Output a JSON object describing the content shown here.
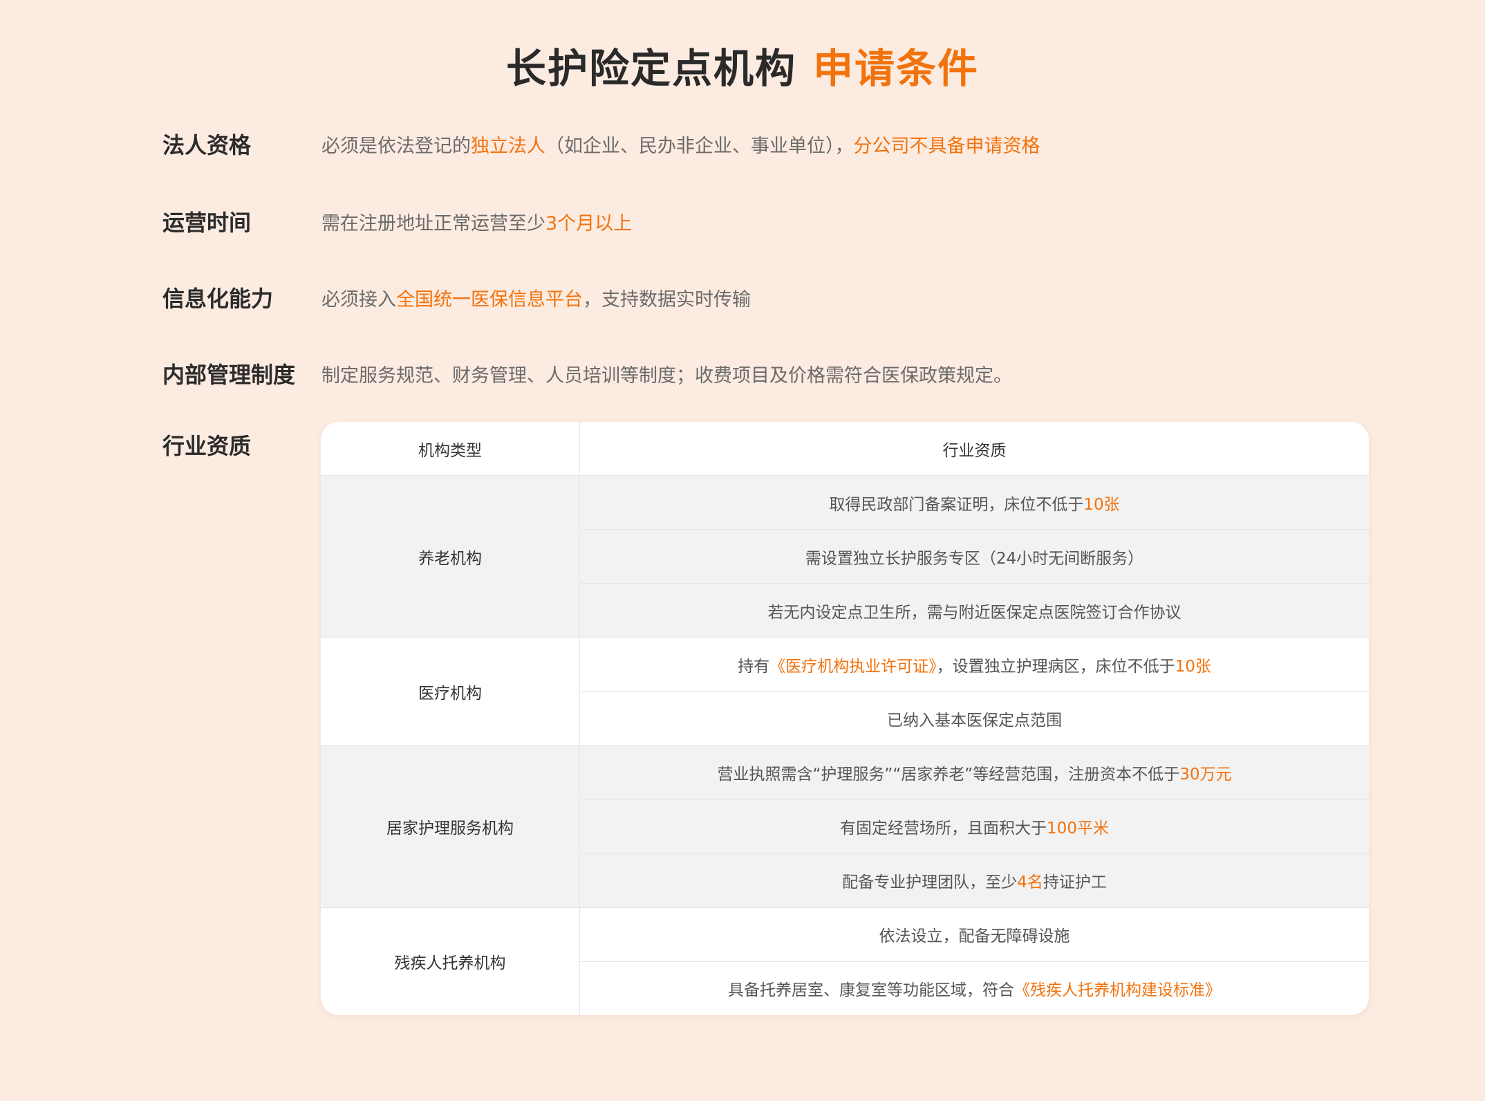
{
  "title": {
    "main": "长护险定点机构",
    "highlight": "申请条件"
  },
  "requirements": [
    {
      "label": "法人资格",
      "segments": [
        {
          "text": "必须是依法登记的",
          "hl": false
        },
        {
          "text": "独立法人",
          "hl": true
        },
        {
          "text": "（如企业、民办非企业、事业单位），",
          "hl": false
        },
        {
          "text": "分公司不具备申请资格",
          "hl": true
        }
      ]
    },
    {
      "label": "运营时间",
      "segments": [
        {
          "text": "需在注册地址正常运营至少",
          "hl": false
        },
        {
          "text": "3个月以上",
          "hl": true
        }
      ]
    },
    {
      "label": "信息化能力",
      "segments": [
        {
          "text": "必须接入",
          "hl": false
        },
        {
          "text": "全国统一医保信息平台",
          "hl": true
        },
        {
          "text": "，支持数据实时传输",
          "hl": false
        }
      ]
    },
    {
      "label": "内部管理制度",
      "segments": [
        {
          "text": "制定服务规范、财务管理、人员培训等制度；收费项目及价格需符合医保政策规定。",
          "hl": false
        }
      ]
    }
  ],
  "qualification": {
    "label": "行业资质",
    "headers": {
      "type": "机构类型",
      "qual": "行业资质"
    },
    "groups": [
      {
        "type": "养老机构",
        "shaded": true,
        "items": [
          [
            {
              "text": "取得民政部门备案证明，床位不低于",
              "hl": false
            },
            {
              "text": "10张",
              "hl": true
            }
          ],
          [
            {
              "text": "需设置独立长护服务专区（24小时无间断服务）",
              "hl": false
            }
          ],
          [
            {
              "text": "若无内设定点卫生所，需与附近医保定点医院签订合作协议",
              "hl": false
            }
          ]
        ]
      },
      {
        "type": "医疗机构",
        "shaded": false,
        "items": [
          [
            {
              "text": "持有",
              "hl": false
            },
            {
              "text": "《医疗机构执业许可证》",
              "hl": true
            },
            {
              "text": "，设置独立护理病区，床位不低于",
              "hl": false
            },
            {
              "text": "10张",
              "hl": true
            }
          ],
          [
            {
              "text": "已纳入基本医保定点范围",
              "hl": false
            }
          ]
        ]
      },
      {
        "type": "居家护理服务机构",
        "shaded": true,
        "items": [
          [
            {
              "text": "营业执照需含“护理服务”“居家养老”等经营范围，注册资本不低于",
              "hl": false
            },
            {
              "text": "30万元",
              "hl": true
            }
          ],
          [
            {
              "text": "有固定经营场所，且面积大于",
              "hl": false
            },
            {
              "text": "100平米",
              "hl": true
            }
          ],
          [
            {
              "text": "配备专业护理团队，至少",
              "hl": false
            },
            {
              "text": "4名",
              "hl": true
            },
            {
              "text": "持证护工",
              "hl": false
            }
          ]
        ]
      },
      {
        "type": "残疾人托养机构",
        "shaded": false,
        "items": [
          [
            {
              "text": "依法设立，配备无障碍设施",
              "hl": false
            }
          ],
          [
            {
              "text": "具备托养居室、康复室等功能区域，符合",
              "hl": false
            },
            {
              "text": "《残疾人托养机构建设标准》",
              "hl": true
            }
          ]
        ]
      }
    ]
  }
}
